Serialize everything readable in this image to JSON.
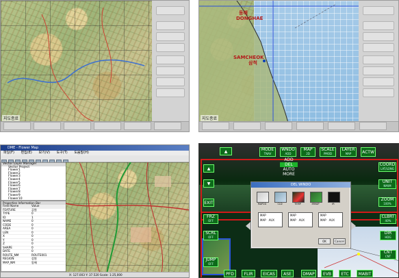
{
  "panel1": {
    "status_text": "지도종료",
    "sidebar_buttons": 8,
    "bottom_buttons": 6
  },
  "panel2": {
    "place1_en": "DONGHAE",
    "place1_ko": "동해",
    "place2_en": "SAMCHEOK",
    "place2_ko": "삼척",
    "status_text": "지도종료"
  },
  "panel3": {
    "window_title": "DME - Flower Map",
    "menu": [
      "파일(F)",
      "편집(E)",
      "보기(V)",
      "도구(T)",
      "도움말(H)"
    ],
    "tree_header": "Vector Layer Manager",
    "tree_items": [
      "Vector Project",
      "Flower1",
      "Flower2",
      "Flower3",
      "Flower4",
      "Flower5",
      "Flower6",
      "Flower7",
      "Flower8",
      "Flower9",
      "Flower10"
    ],
    "props_header": "Properties Information Bar",
    "props_columns": [
      "Field Name",
      "Value"
    ],
    "props_rows": [
      [
        "FEATURE",
        "공원"
      ],
      [
        "TYPE",
        "0"
      ],
      [
        "ID",
        "1"
      ],
      [
        "NAME",
        "0"
      ],
      [
        "CODE",
        "0"
      ],
      [
        "AREA",
        "0"
      ],
      [
        "LEN",
        "0"
      ],
      [
        "X",
        "0"
      ],
      [
        "Y",
        "0"
      ],
      [
        "Z",
        "0"
      ],
      [
        "SHAPE",
        "0"
      ],
      [
        "DATE",
        "0"
      ],
      [
        "ROUTE_NM",
        "ROUTE001"
      ],
      [
        "REGION",
        "강원"
      ],
      [
        "MAP_NM",
        "동해"
      ]
    ],
    "status_text": "X: 127.003   Y: 37.520   Scale: 1:25,000"
  },
  "panel4": {
    "top_buttons": [
      {
        "label": "▲"
      },
      {
        "label": "MODE",
        "sub": "TNAV"
      },
      {
        "label": "WNDO",
        "sub": "ADD"
      },
      {
        "label": "MAP",
        "sub": "2D"
      },
      {
        "label": "SCALE",
        "sub": "PMOD"
      },
      {
        "label": "LAYER",
        "sub": "MAP"
      },
      {
        "label": "ACTW"
      }
    ],
    "wndo_menu": [
      "ADD",
      "DEL",
      "AUTO",
      "MORE"
    ],
    "left_buttons": [
      "▲",
      "▼",
      "EXIT"
    ],
    "right_buttons": [
      {
        "label": "COORD",
        "sub": "LAT/LONG"
      },
      {
        "label": "UNIT",
        "sub": "NM/M"
      },
      {
        "label": "ZOOM",
        "sub": "100%"
      }
    ],
    "dialog_title": "DEL WINDO",
    "thumbnails": [
      "MAP2D",
      "CLD",
      "TEMP",
      "IRMAP",
      "IR"
    ],
    "dialog_rows": [
      [
        "MAP",
        "MAP",
        "MAP"
      ],
      [
        "MAP",
        "AUX",
        "MAP",
        "AUX",
        "MAP",
        "AUX"
      ]
    ],
    "dialog_ok": "OK",
    "dialog_cancel": "Cancel",
    "side_buttons_left": [
      {
        "label": "FRZ",
        "sub": "OFF"
      },
      {
        "label": "SCRL",
        "sub": "OFF"
      },
      {
        "label": "JUMP",
        "sub": "OFF"
      }
    ],
    "side_buttons_right": [
      {
        "label": "CLBRT",
        "sub": "40%"
      },
      {
        "label": "DIR",
        "sub": "HDG"
      },
      {
        "label": "CNT",
        "sub": "CNT"
      }
    ],
    "bottom_buttons": [
      "PFD",
      "FLIR",
      "EICAS",
      "ASE",
      "DMAP",
      "EVB",
      "ETC",
      "MABIT"
    ]
  }
}
